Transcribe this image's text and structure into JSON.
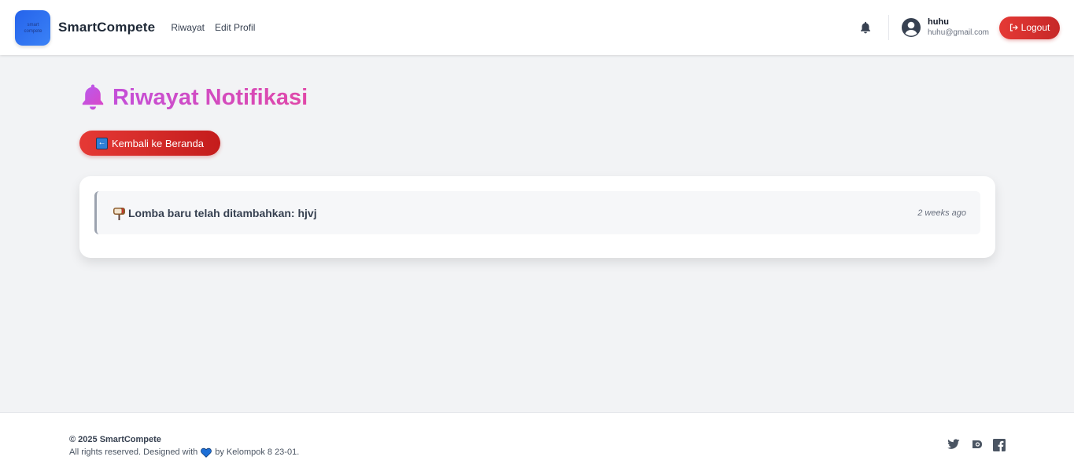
{
  "header": {
    "brand": "SmartCompete",
    "logo_text": "smart compete",
    "nav": [
      "Riwayat",
      "Edit Profil"
    ],
    "user": {
      "name": "huhu",
      "email": "huhu@gmail.com"
    },
    "logout_label": "Logout"
  },
  "main": {
    "title": "Riwayat Notifikasi",
    "back_label": "Kembali ke Beranda",
    "notifications": [
      {
        "icon": "mailbox-icon",
        "text": "Lomba baru telah ditambahkan: hjvj",
        "time": "2 weeks ago"
      }
    ]
  },
  "footer": {
    "copyright": "© 2025 SmartCompete",
    "rights_prefix": "All rights reserved. Designed with",
    "rights_suffix": "by Kelompok 8 23-01.",
    "socials": [
      "twitter-icon",
      "instagram-icon",
      "facebook-icon"
    ]
  },
  "colors": {
    "accent_red": "#e53935",
    "title_pink": "#d946b8",
    "brand_blue": "#2563eb"
  }
}
